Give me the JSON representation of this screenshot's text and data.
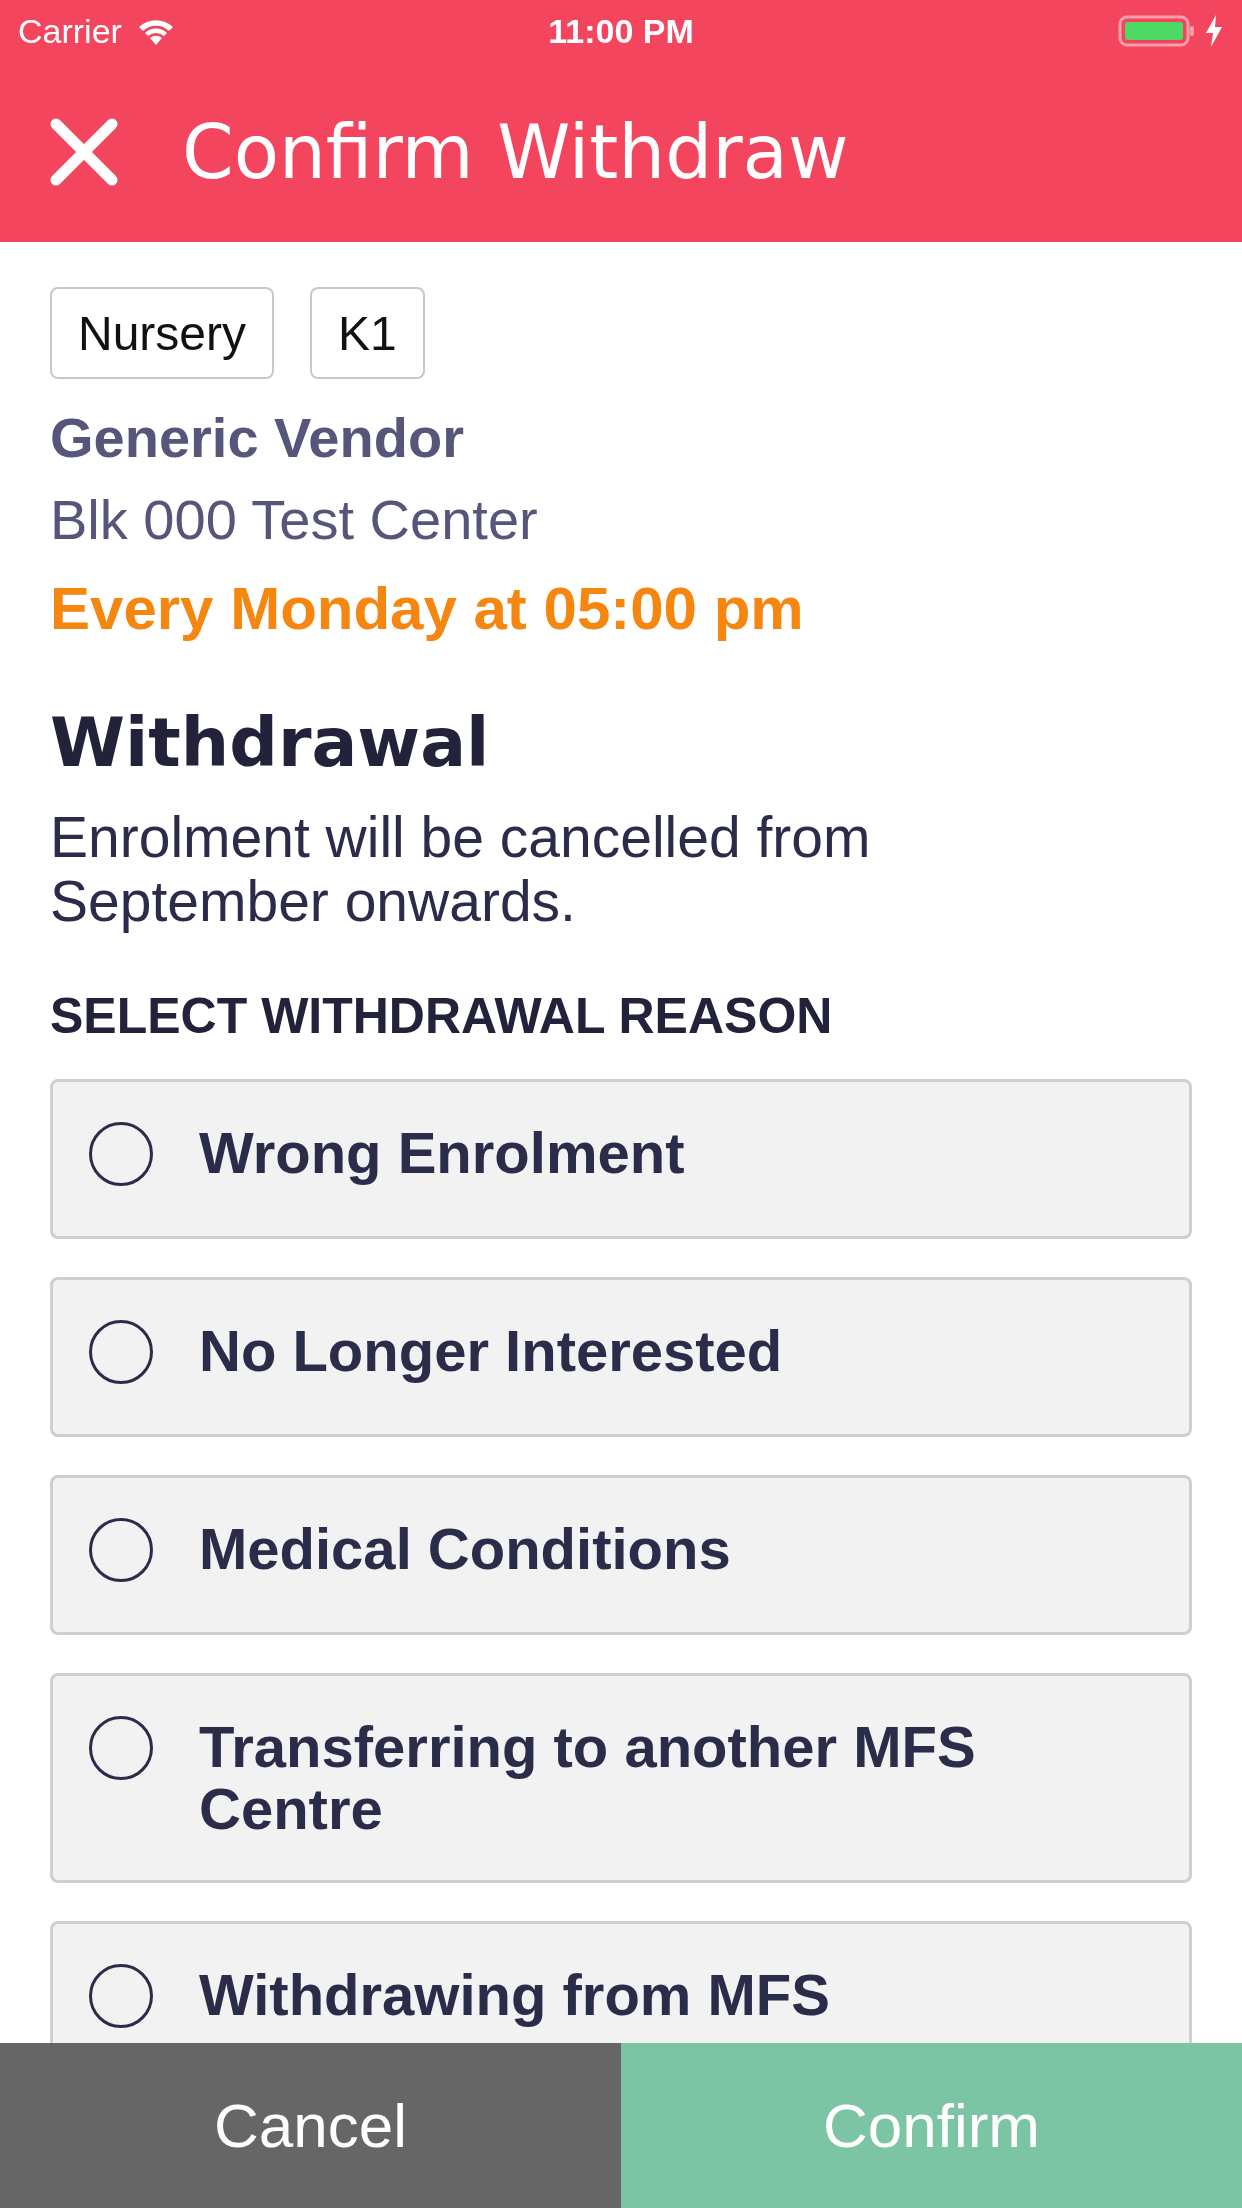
{
  "status_bar": {
    "carrier": "Carrier",
    "time": "11:00 PM"
  },
  "header": {
    "title": "Confirm Withdraw"
  },
  "program": {
    "tags": [
      "Nursery",
      "K1"
    ],
    "vendor": "Generic Vendor",
    "address": "Blk 000 Test Center",
    "schedule": "Every Monday at 05:00 pm"
  },
  "withdrawal": {
    "heading": "Withdrawal",
    "message": "Enrolment will be cancelled from September onwards.",
    "reason_label": "SELECT WITHDRAWAL REASON",
    "reasons": [
      {
        "label": "Wrong Enrolment",
        "selected": false
      },
      {
        "label": "No Longer Interested",
        "selected": false
      },
      {
        "label": "Medical Conditions",
        "selected": false
      },
      {
        "label": "Transferring to another MFS Centre",
        "selected": false
      },
      {
        "label": "Withdrawing from MFS",
        "selected": false
      }
    ]
  },
  "buttons": {
    "cancel": "Cancel",
    "confirm": "Confirm"
  }
}
